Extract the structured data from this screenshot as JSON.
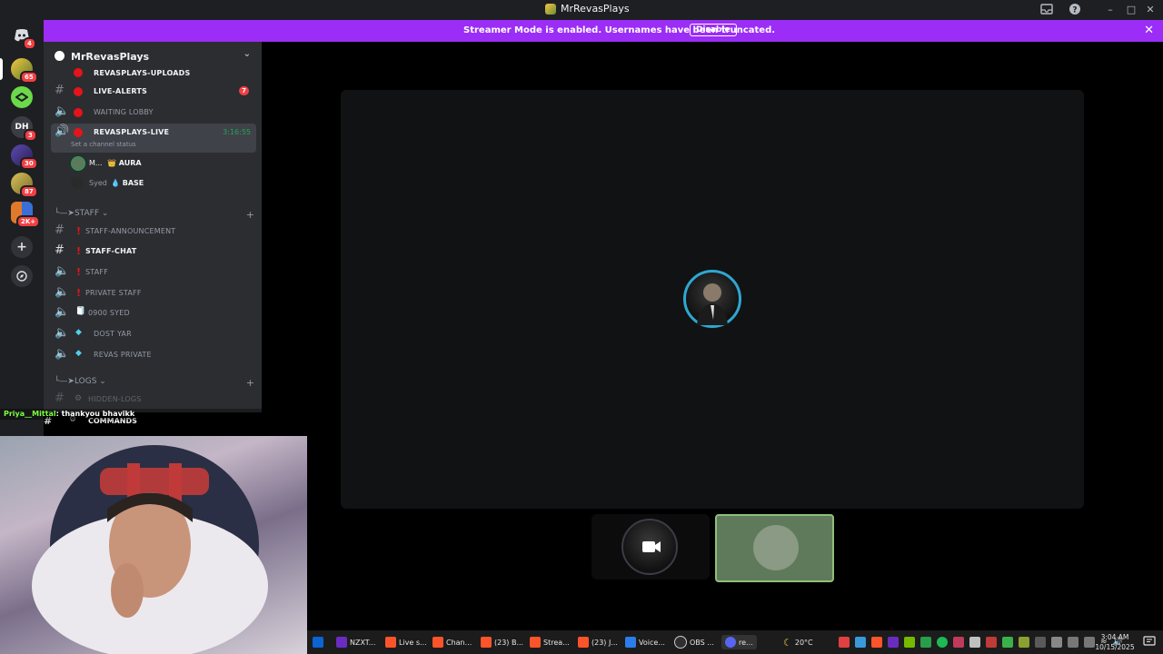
{
  "window": {
    "title": "MrRevasPlays",
    "buttons": [
      "inbox-icon",
      "help-icon",
      "minimize",
      "maximize",
      "close"
    ]
  },
  "banner": {
    "message": "Streamer Mode is enabled. Usernames have been truncated.",
    "disable_label": "Disable",
    "color": "#9b2df7"
  },
  "rail": {
    "home_badge": "4",
    "servers": [
      {
        "badge": "65",
        "active": true
      },
      {
        "badge": "",
        "active": false
      },
      {
        "label": "DH",
        "badge": "3",
        "active": false
      },
      {
        "badge": "30",
        "active": false
      },
      {
        "badge": "87",
        "active": false
      },
      {
        "badge": "2K+",
        "active": false
      }
    ]
  },
  "guild": {
    "name": "MrRevasPlays"
  },
  "channels": [
    {
      "name": "REVASPLAYS-UPLOADS",
      "type": "text",
      "marker": "dot",
      "bold": true,
      "badge": ""
    },
    {
      "name": "LIVE-ALERTS",
      "type": "text",
      "marker": "dot",
      "bold": true,
      "badge": "7"
    },
    {
      "name": "WAITING LOBBY",
      "type": "voice",
      "marker": "dot",
      "bold": false,
      "badge": ""
    },
    {
      "name": "REVASPLAYS-LIVE",
      "type": "voice",
      "marker": "dot",
      "bold": true,
      "badge": "",
      "timer": "3:16:55",
      "status": "Set a channel status"
    }
  ],
  "voice_users": [
    {
      "name": "M...",
      "role": "AURA"
    },
    {
      "name": "Syed",
      "role": "BASE"
    }
  ],
  "staff_category": {
    "label": "STAFF",
    "channels": [
      {
        "name": "STAFF-ANNOUNCEMENT",
        "type": "text",
        "bold": false
      },
      {
        "name": "STAFF-CHAT",
        "type": "text",
        "bold": true
      },
      {
        "name": "STAFF",
        "type": "voice",
        "bold": false
      },
      {
        "name": "PRIVATE STAFF",
        "type": "voice",
        "bold": false
      },
      {
        "name": "0900 SYED",
        "type": "voice",
        "bold": false
      },
      {
        "name": "DOST YAR",
        "type": "voice",
        "bold": false
      },
      {
        "name": "REVAS PRIVATE",
        "type": "voice",
        "bold": false
      }
    ]
  },
  "logs_category": {
    "label": "LOGS",
    "channels": [
      {
        "name": "HIDDEN-LOGS",
        "type": "text",
        "bold": false
      },
      {
        "name": "COMMANDS",
        "type": "text",
        "bold": true
      }
    ]
  },
  "chat_overlay": {
    "user": "Priya__Mittal",
    "message": ": thankyou bhavikk"
  },
  "taskbar": {
    "apps": [
      "NZXT...",
      "Live s...",
      "Chan...",
      "(23) B...",
      "Strea...",
      "(23) J...",
      "Voice...",
      "OBS ...",
      "re..."
    ],
    "weather": "20°C",
    "time": "3:04 AM",
    "date": "10/15/2025"
  }
}
